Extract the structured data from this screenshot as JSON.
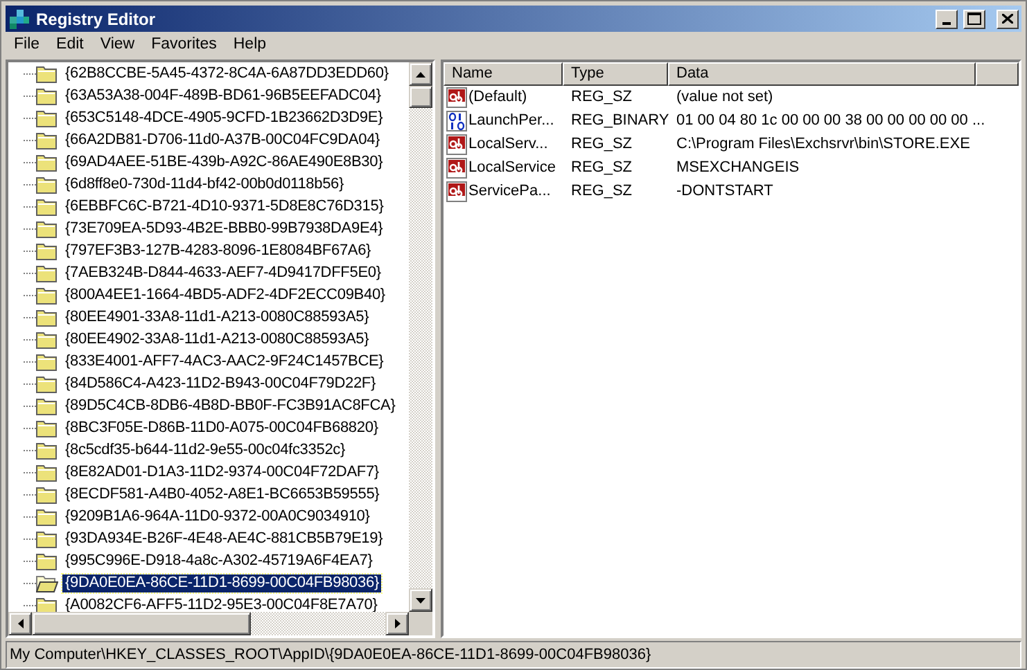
{
  "window": {
    "title": "Registry Editor"
  },
  "menu": [
    "File",
    "Edit",
    "View",
    "Favorites",
    "Help"
  ],
  "tree": {
    "items": [
      {
        "label": "{62B8CCBE-5A45-4372-8C4A-6A87DD3EDD60}",
        "selected": false
      },
      {
        "label": "{63A53A38-004F-489B-BD61-96B5EEFADC04}",
        "selected": false
      },
      {
        "label": "{653C5148-4DCE-4905-9CFD-1B23662D3D9E}",
        "selected": false
      },
      {
        "label": "{66A2DB81-D706-11d0-A37B-00C04FC9DA04}",
        "selected": false
      },
      {
        "label": "{69AD4AEE-51BE-439b-A92C-86AE490E8B30}",
        "selected": false
      },
      {
        "label": "{6d8ff8e0-730d-11d4-bf42-00b0d0118b56}",
        "selected": false
      },
      {
        "label": "{6EBBFC6C-B721-4D10-9371-5D8E8C76D315}",
        "selected": false
      },
      {
        "label": "{73E709EA-5D93-4B2E-BBB0-99B7938DA9E4}",
        "selected": false
      },
      {
        "label": "{797EF3B3-127B-4283-8096-1E8084BF67A6}",
        "selected": false
      },
      {
        "label": "{7AEB324B-D844-4633-AEF7-4D9417DFF5E0}",
        "selected": false
      },
      {
        "label": "{800A4EE1-1664-4BD5-ADF2-4DF2ECC09B40}",
        "selected": false
      },
      {
        "label": "{80EE4901-33A8-11d1-A213-0080C88593A5}",
        "selected": false
      },
      {
        "label": "{80EE4902-33A8-11d1-A213-0080C88593A5}",
        "selected": false
      },
      {
        "label": "{833E4001-AFF7-4AC3-AAC2-9F24C1457BCE}",
        "selected": false
      },
      {
        "label": "{84D586C4-A423-11D2-B943-00C04F79D22F}",
        "selected": false
      },
      {
        "label": "{89D5C4CB-8DB6-4B8D-BB0F-FC3B91AC8FCA}",
        "selected": false
      },
      {
        "label": "{8BC3F05E-D86B-11D0-A075-00C04FB68820}",
        "selected": false
      },
      {
        "label": "{8c5cdf35-b644-11d2-9e55-00c04fc3352c}",
        "selected": false
      },
      {
        "label": "{8E82AD01-D1A3-11D2-9374-00C04F72DAF7}",
        "selected": false
      },
      {
        "label": "{8ECDF581-A4B0-4052-A8E1-BC6653B59555}",
        "selected": false
      },
      {
        "label": "{9209B1A6-964A-11D0-9372-00A0C9034910}",
        "selected": false
      },
      {
        "label": "{93DA934E-B26F-4E48-AE4C-881CB5B79E19}",
        "selected": false
      },
      {
        "label": "{995C996E-D918-4a8c-A302-45719A6F4EA7}",
        "selected": false
      },
      {
        "label": "{9DA0E0EA-86CE-11D1-8699-00C04FB98036}",
        "selected": true
      },
      {
        "label": "{A0082CF6-AFF5-11D2-95E3-00C04F8E7A70}",
        "selected": false
      }
    ]
  },
  "values": {
    "columns": [
      "Name",
      "Type",
      "Data"
    ],
    "rows": [
      {
        "kind": "string",
        "name": "(Default)",
        "type": "REG_SZ",
        "data": "(value not set)"
      },
      {
        "kind": "binary",
        "name": "LaunchPer...",
        "type": "REG_BINARY",
        "data": "01 00 04 80 1c 00 00 00 38 00 00 00 00 00 ..."
      },
      {
        "kind": "string",
        "name": "LocalServ...",
        "type": "REG_SZ",
        "data": "C:\\Program Files\\Exchsrvr\\bin\\STORE.EXE"
      },
      {
        "kind": "string",
        "name": "LocalService",
        "type": "REG_SZ",
        "data": "MSEXCHANGEIS"
      },
      {
        "kind": "string",
        "name": "ServicePa...",
        "type": "REG_SZ",
        "data": "-DONTSTART"
      }
    ]
  },
  "status_bar": "My Computer\\HKEY_CLASSES_ROOT\\AppID\\{9DA0E0EA-86CE-11D1-8699-00C04FB98036}"
}
